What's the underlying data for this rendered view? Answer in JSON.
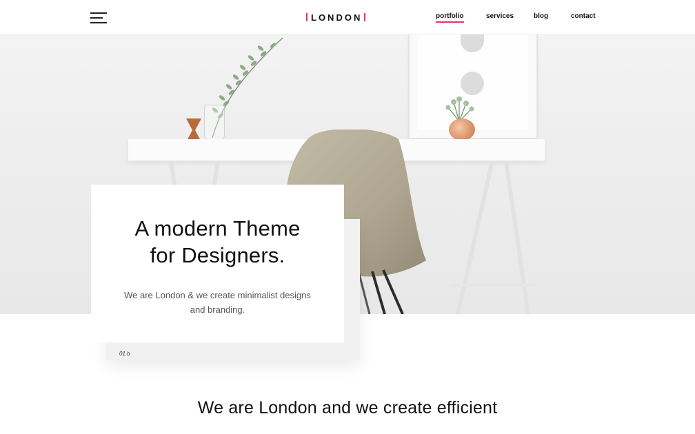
{
  "header": {
    "logo_text": "LONDON",
    "accent_color": "#e8307a",
    "nav": [
      {
        "label": "portfolio",
        "active": true
      },
      {
        "label": "services",
        "active": false
      },
      {
        "label": "blog",
        "active": false
      },
      {
        "label": "contact",
        "active": false
      }
    ]
  },
  "hero": {
    "card_title_line1": "A modern Theme",
    "card_title_line2": "for Designers.",
    "card_description": "We are London & we create minimalist designs and branding.",
    "slide_label": "01.b"
  },
  "intro": {
    "heading": "We are London and we create efficient"
  },
  "icons": [
    "menu-icon"
  ]
}
